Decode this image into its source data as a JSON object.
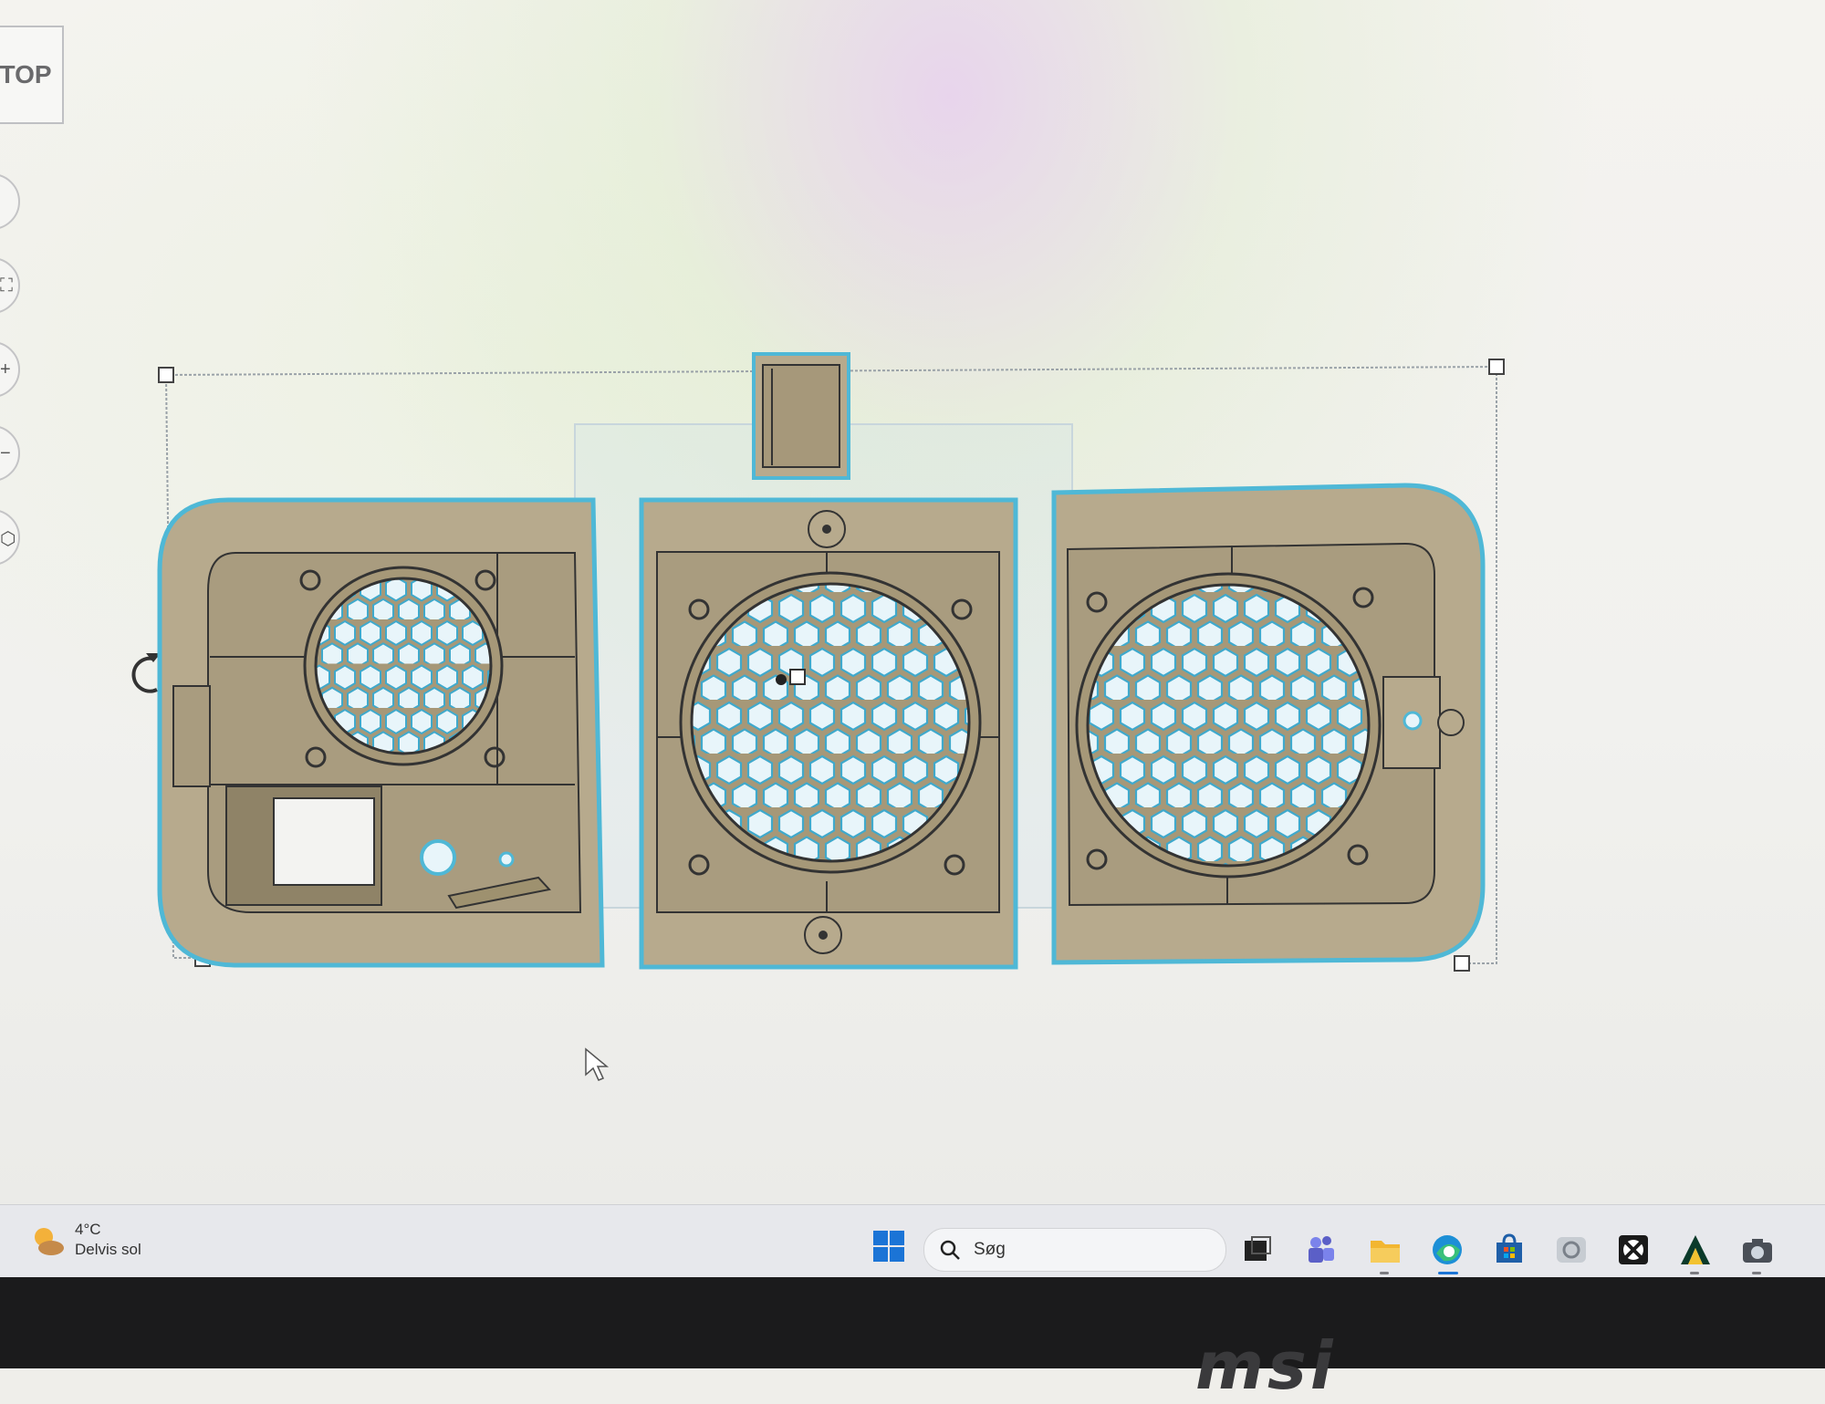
{
  "viewcube": {
    "label": "TOP"
  },
  "nav_buttons": [
    "home-view-button",
    "fit-view-button",
    "zoom-in-button",
    "zoom-out-button",
    "perspective-button"
  ],
  "taskbar": {
    "weather": {
      "temperature": "4°C",
      "condition": "Delvis sol"
    },
    "search": {
      "placeholder": "Søg"
    },
    "apps": [
      "task-view",
      "teams",
      "file-explorer",
      "edge",
      "microsoft-store",
      "app-icon",
      "xbox",
      "autodesk",
      "camera"
    ]
  },
  "monitor": {
    "brand": "msi"
  },
  "colors": {
    "part_fill": "#b7aa8d",
    "selection_outline": "#4fb8d6",
    "grille_cell": "#e9f6fb",
    "taskbar_bg": "#e7e8ec",
    "windows_blue": "#1b74d6"
  }
}
